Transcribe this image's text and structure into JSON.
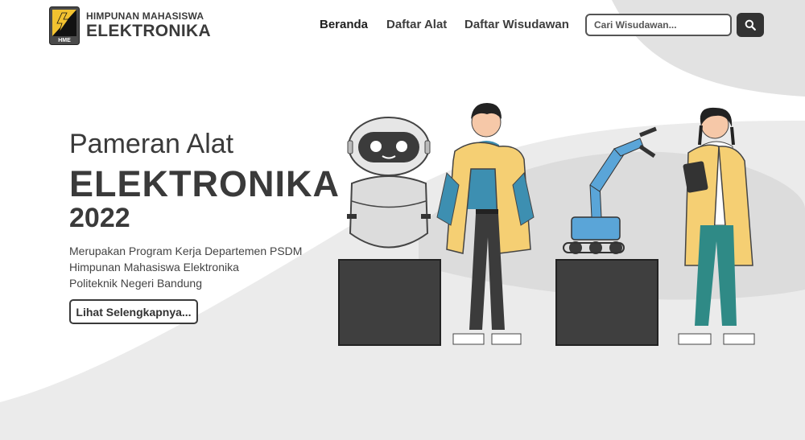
{
  "header": {
    "org_small": "HIMPUNAN MAHASISWA",
    "org_main": "ELEKTRONIKA",
    "logo_text": "HME"
  },
  "nav": {
    "items": [
      {
        "label": "Beranda",
        "active": true
      },
      {
        "label": "Daftar Alat",
        "active": false
      },
      {
        "label": "Daftar Wisudawan",
        "active": false
      }
    ]
  },
  "search": {
    "placeholder": "Cari Wisudawan...",
    "button_icon": "search-icon"
  },
  "hero": {
    "title_line1": "Pameran Alat",
    "title_line2": "ELEKTRONIKA",
    "title_line3": "2022",
    "description": [
      "Merupakan Program Kerja Departemen PSDM",
      "Himpunan Mahasiswa Elektronika",
      "Politeknik Negeri Bandung"
    ],
    "cta_label": "Lihat Selengkapnya..."
  },
  "colors": {
    "dark": "#3a3a3a",
    "bg_gray": "#ebebeb",
    "accent_yellow": "#f7d36b",
    "accent_blue": "#5aa5d8",
    "accent_teal": "#2f8a86"
  }
}
